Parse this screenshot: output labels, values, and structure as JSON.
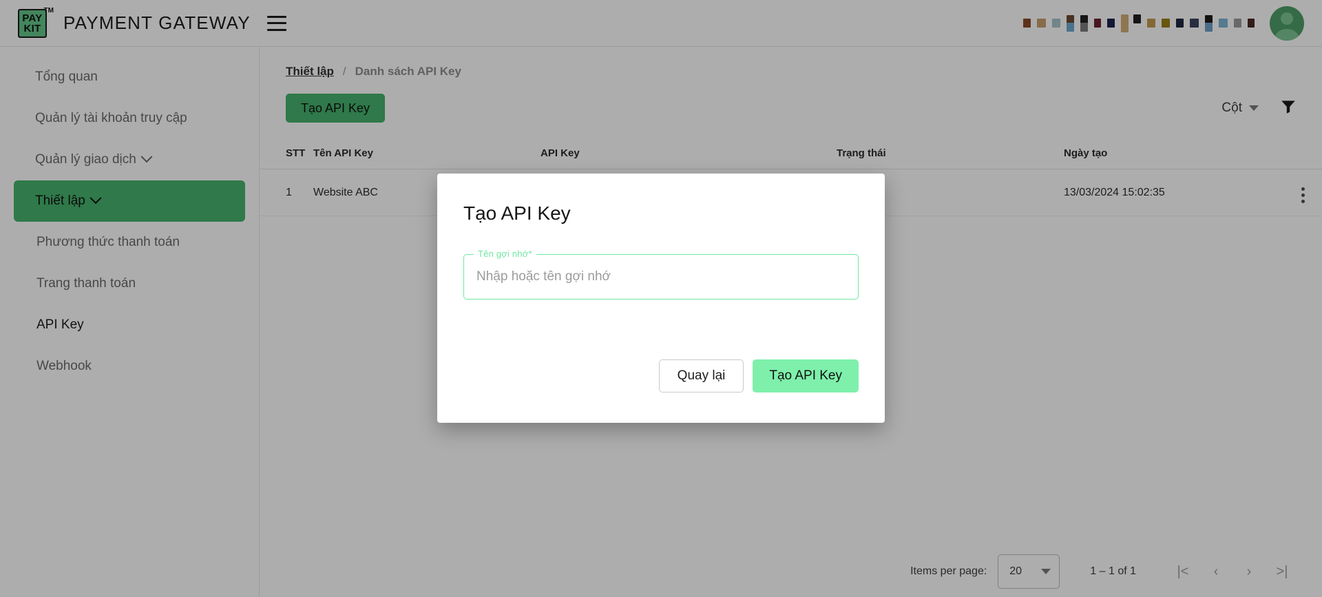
{
  "header": {
    "logo_line1": "PAY",
    "logo_line2": "KIT",
    "logo_tm": "TM",
    "title": "PAYMENT GATEWAY",
    "menu_icon": "hamburger-icon",
    "user_name_redacted": "",
    "avatar_icon": "user-avatar-icon"
  },
  "sidebar": {
    "items": [
      {
        "label": "Tổng quan",
        "active": false,
        "expandable": false,
        "sub": false
      },
      {
        "label": "Quản lý tài khoản truy cập",
        "active": false,
        "expandable": false,
        "sub": false
      },
      {
        "label": "Quản lý giao dịch",
        "active": false,
        "expandable": true,
        "sub": false
      },
      {
        "label": "Thiết lập",
        "active": true,
        "expandable": true,
        "sub": false
      },
      {
        "label": "Phương thức thanh toán",
        "active": false,
        "expandable": false,
        "sub": true
      },
      {
        "label": "Trang thanh toán",
        "active": false,
        "expandable": false,
        "sub": true
      },
      {
        "label": "API Key",
        "active": false,
        "expandable": false,
        "sub": true,
        "current": true
      },
      {
        "label": "Webhook",
        "active": false,
        "expandable": false,
        "sub": true
      }
    ]
  },
  "breadcrumb": {
    "parent": "Thiết lập",
    "separator": "/",
    "current": "Danh sách API Key"
  },
  "toolbar": {
    "create_label": "Tạo API Key",
    "columns_label": "Cột",
    "columns_caret_icon": "chevron-down-icon",
    "filter_icon": "funnel-filter-icon"
  },
  "table": {
    "columns": [
      "STT",
      "Tên API Key",
      "API Key",
      "Trạng thái",
      "Ngày tạo",
      ""
    ],
    "rows": [
      {
        "stt": "1",
        "name": "Website ABC",
        "api_key": "",
        "status": "",
        "created_at": "13/03/2024 15:02:35",
        "actions_icon": "more-vertical-icon"
      }
    ]
  },
  "paginator": {
    "items_per_page_label": "Items per page:",
    "page_size": "20",
    "page_size_caret_icon": "chevron-down-icon",
    "range_label": "1 – 1 of 1",
    "first_icon": "|<",
    "prev_icon": "‹",
    "next_icon": "›",
    "last_icon": ">|"
  },
  "modal": {
    "title": "Tạo API Key",
    "field_label": "Tên gợi nhớ*",
    "field_value": "",
    "field_placeholder": "Nhập hoặc tên gợi nhớ",
    "cancel_label": "Quay lại",
    "submit_label": "Tạo API Key"
  },
  "colors": {
    "brand_green": "#46b36e",
    "accent_green": "#7ef0ab",
    "field_green": "#6ee7a2",
    "avatar_green": "#4f9e68",
    "muted_text": "#6b6b6b"
  }
}
